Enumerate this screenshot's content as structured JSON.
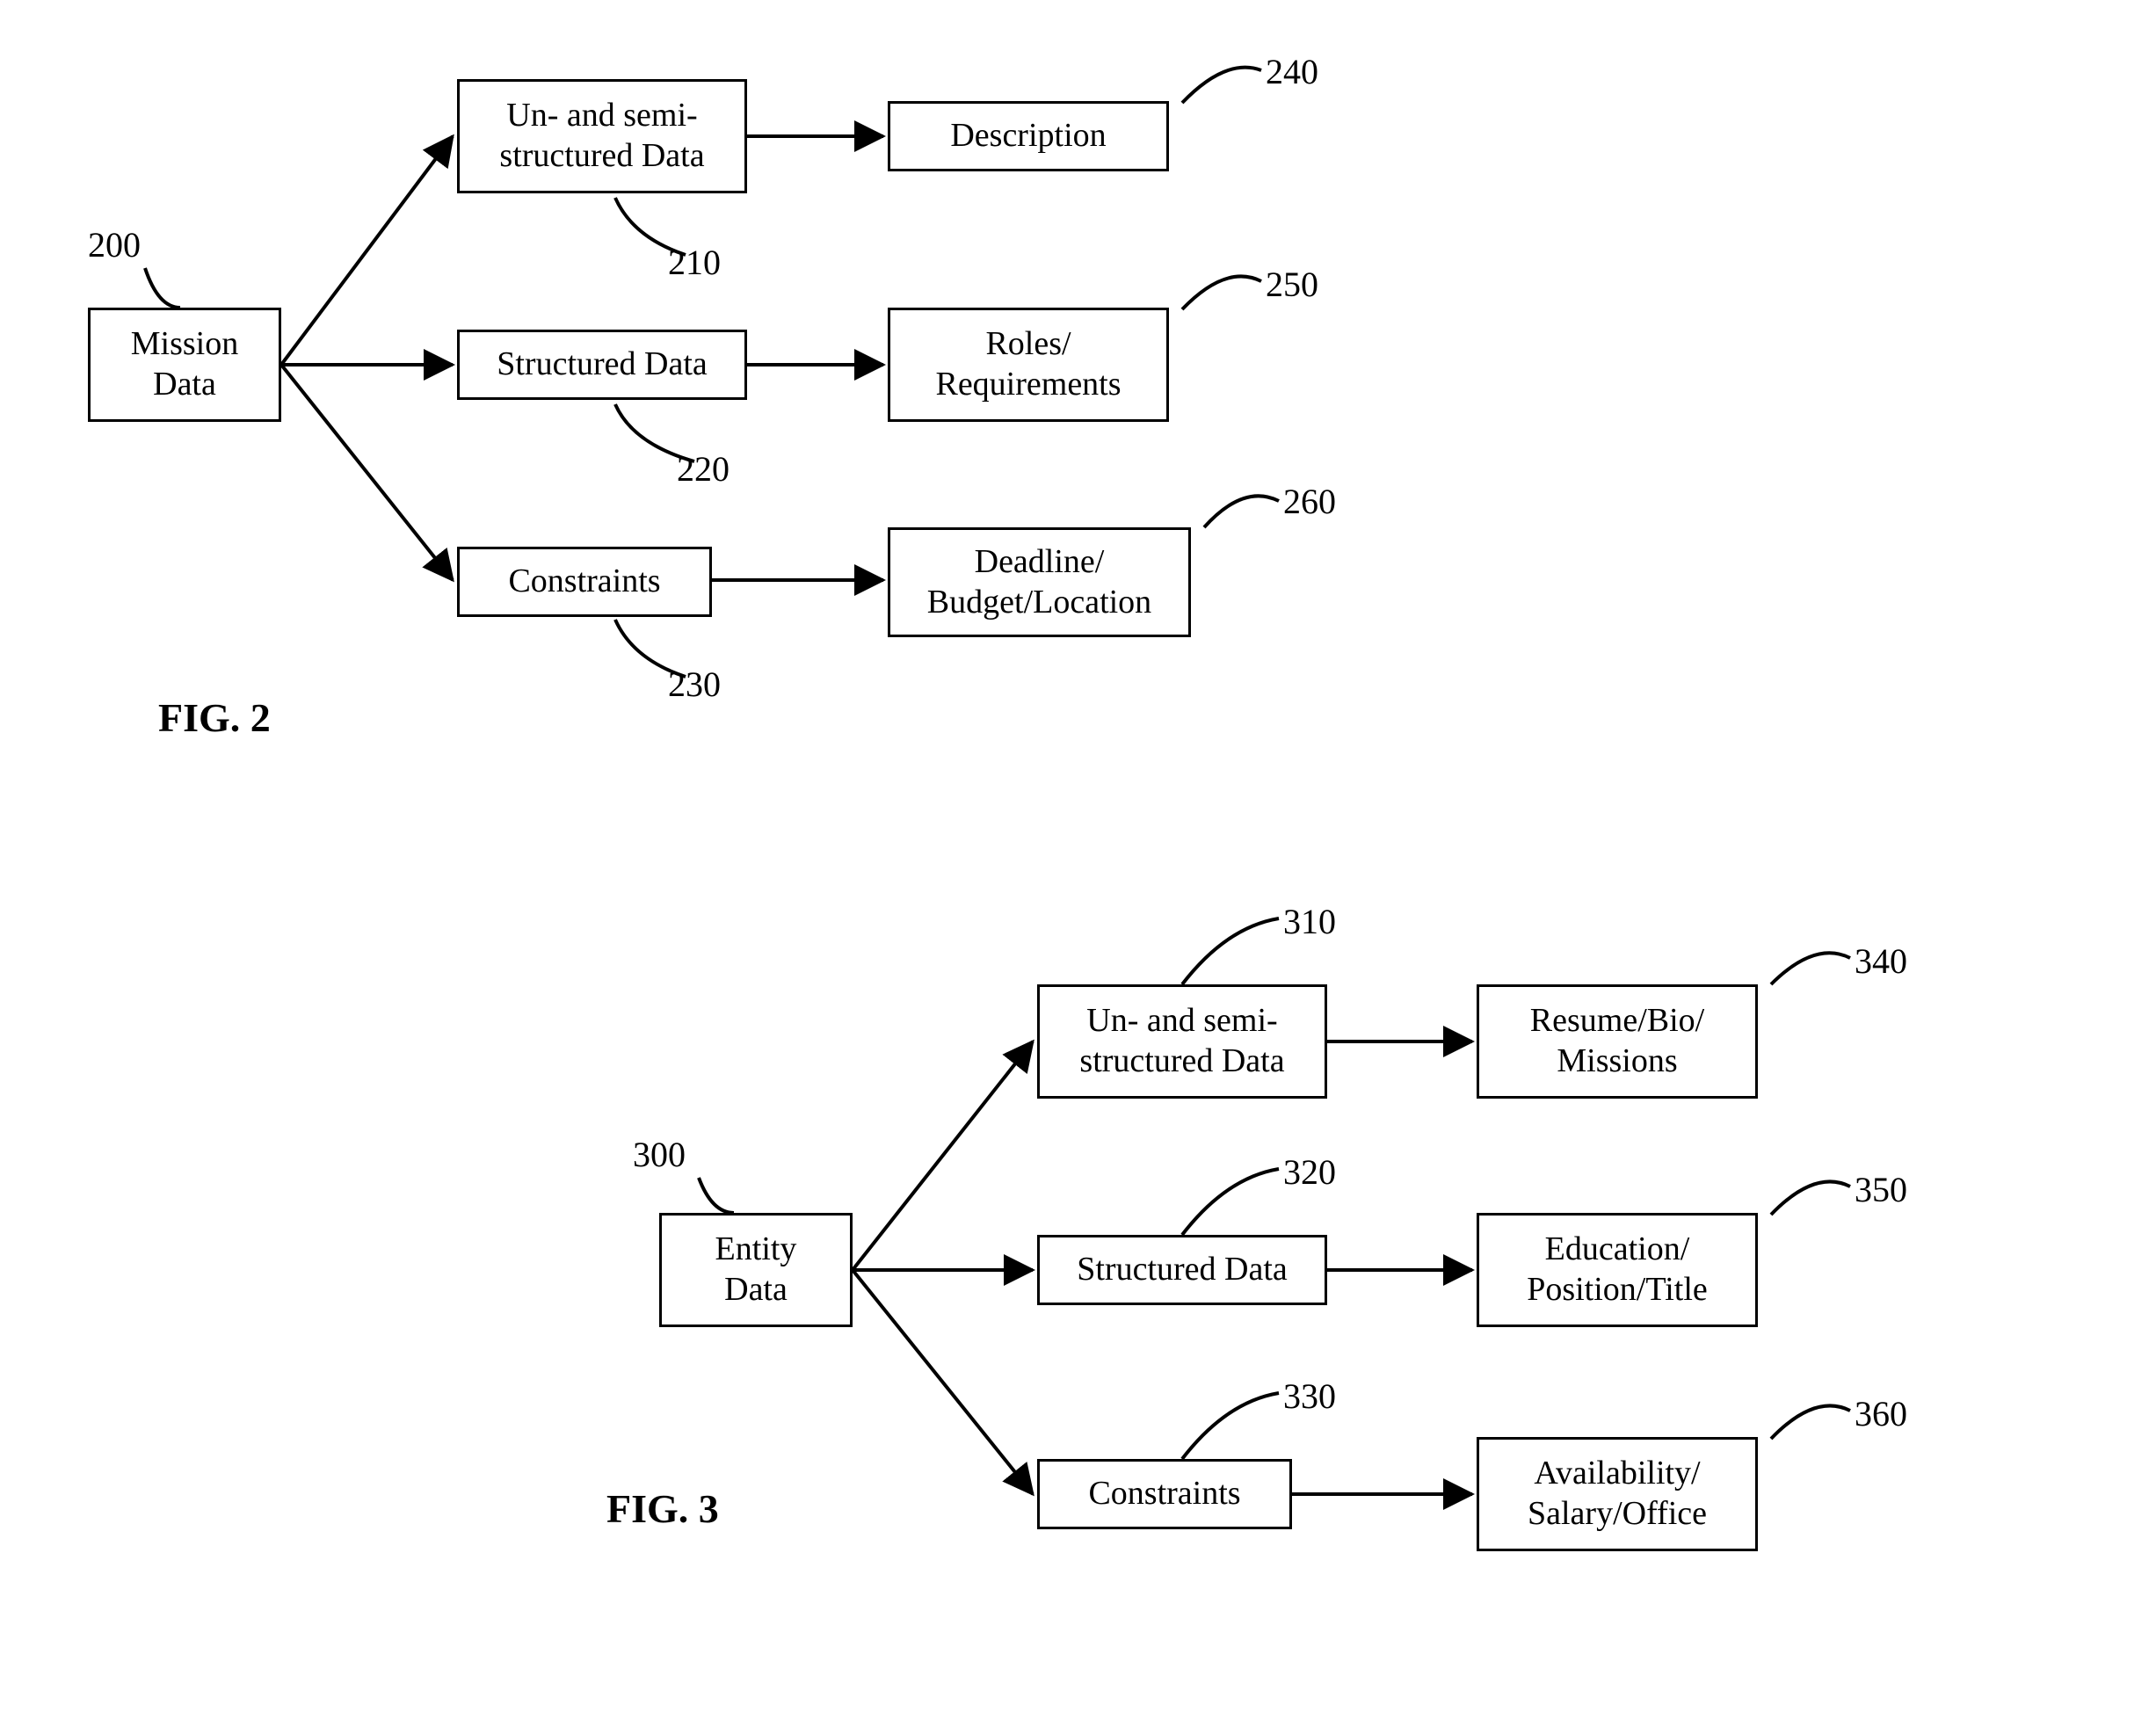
{
  "fig2": {
    "caption": "FIG. 2",
    "root": {
      "label": "Mission\nData",
      "ref": "200"
    },
    "mid1": {
      "label": "Un- and semi-\nstructured Data",
      "ref": "210"
    },
    "mid2": {
      "label": "Structured Data",
      "ref": "220"
    },
    "mid3": {
      "label": "Constraints",
      "ref": "230"
    },
    "leaf1": {
      "label": "Description",
      "ref": "240"
    },
    "leaf2": {
      "label": "Roles/\nRequirements",
      "ref": "250"
    },
    "leaf3": {
      "label": "Deadline/\nBudget/Location",
      "ref": "260"
    }
  },
  "fig3": {
    "caption": "FIG. 3",
    "root": {
      "label": "Entity\nData",
      "ref": "300"
    },
    "mid1": {
      "label": "Un- and semi-\nstructured Data",
      "ref": "310"
    },
    "mid2": {
      "label": "Structured Data",
      "ref": "320"
    },
    "mid3": {
      "label": "Constraints",
      "ref": "330"
    },
    "leaf1": {
      "label": "Resume/Bio/\nMissions",
      "ref": "340"
    },
    "leaf2": {
      "label": "Education/\nPosition/Title",
      "ref": "350"
    },
    "leaf3": {
      "label": "Availability/\nSalary/Office",
      "ref": "360"
    }
  }
}
